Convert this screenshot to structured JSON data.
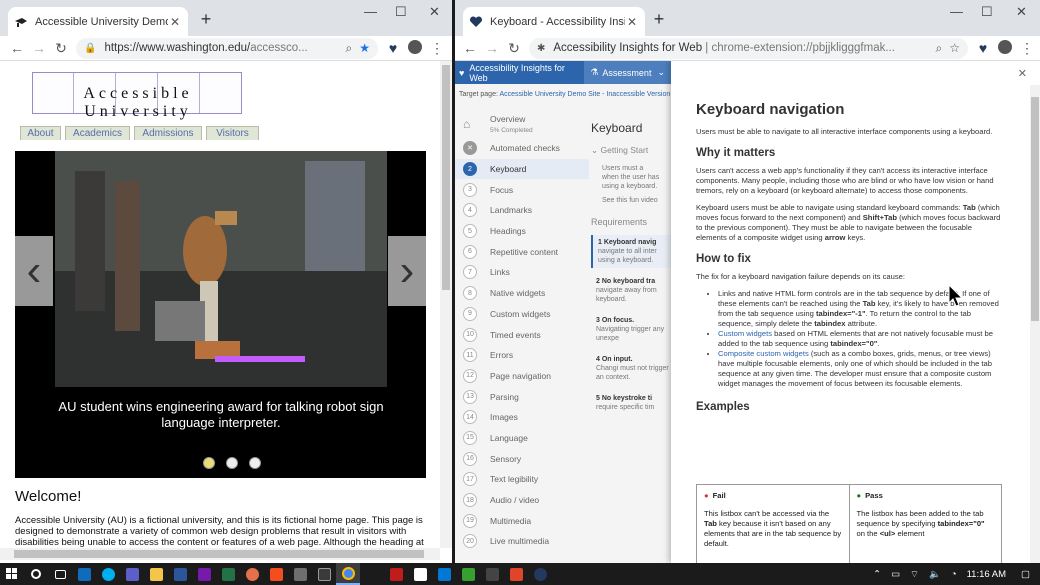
{
  "left": {
    "tab_title": "Accessible University Demo Site",
    "url_host": "https://www.washington.edu/",
    "url_path": "accessco...",
    "logo_text": "Accessible University",
    "nav": [
      "About",
      "Academics",
      "Admissions",
      "Visitors"
    ],
    "caption": "AU student wins engineering award for talking robot sign language interpreter.",
    "welcome": "Welcome!",
    "intro": "Accessible University (AU) is a fictional university, and this is its fictional home page. This page is designed to demonstrate a variety of common web design problems that result in visitors with disabilities being unable to access the content or features of a web page. Although the heading at the"
  },
  "right": {
    "tab_title": "Keyboard - Accessibility Insights",
    "url_label": "Accessibility Insights for Web",
    "url": "chrome-extension://pbjjkligggfmak...",
    "brand": "Accessibility Insights for Web",
    "assessment": "Assessment",
    "target_label": "Target page:",
    "target_link": "Accessible University Demo Site - Inaccessible Version",
    "overview": "Overview",
    "overview_sub": "5% Completed",
    "nav": [
      {
        "n": "",
        "label": "Automated checks"
      },
      {
        "n": "2",
        "label": "Keyboard"
      },
      {
        "n": "3",
        "label": "Focus"
      },
      {
        "n": "4",
        "label": "Landmarks"
      },
      {
        "n": "5",
        "label": "Headings"
      },
      {
        "n": "6",
        "label": "Repetitive content"
      },
      {
        "n": "7",
        "label": "Links"
      },
      {
        "n": "8",
        "label": "Native widgets"
      },
      {
        "n": "9",
        "label": "Custom widgets"
      },
      {
        "n": "10",
        "label": "Timed events"
      },
      {
        "n": "11",
        "label": "Errors"
      },
      {
        "n": "12",
        "label": "Page navigation"
      },
      {
        "n": "13",
        "label": "Parsing"
      },
      {
        "n": "14",
        "label": "Images"
      },
      {
        "n": "15",
        "label": "Language"
      },
      {
        "n": "16",
        "label": "Sensory"
      },
      {
        "n": "17",
        "label": "Text legibility"
      },
      {
        "n": "18",
        "label": "Audio / video"
      },
      {
        "n": "19",
        "label": "Multimedia"
      },
      {
        "n": "20",
        "label": "Live multimedia"
      }
    ],
    "mid_title": "Keyboard",
    "mid_getting": "Getting Start",
    "mid_lines": [
      "Users must a",
      "when the user has",
      "using a keyboard.",
      "See this fun video"
    ],
    "mid_req": "Requirements",
    "mid_items": [
      {
        "h": "1 Keyboard navig",
        "s": "navigate to all inter using a keyboard."
      },
      {
        "h": "2 No keyboard tra",
        "s": "navigate away from keyboard."
      },
      {
        "h": "3 On focus.",
        "s": "Navigating trigger any unexpe"
      },
      {
        "h": "4 On input.",
        "s": "Changi must not trigger an context."
      },
      {
        "h": "5 No keystroke ti",
        "s": "require specific tim"
      }
    ],
    "guide": {
      "h1": "Keyboard navigation",
      "p1": "Users must be able to navigate to all interactive interface components using a keyboard.",
      "h2a": "Why it matters",
      "p2": "Users can't access a web app's functionality if they can't access its interactive interface components. Many people, including those who are blind or who have low vision or hand tremors, rely on a keyboard (or keyboard alternate) to access those components.",
      "p3a": "Keyboard users must be able to navigate using standard keyboard commands: ",
      "p3tab": "Tab",
      "p3b": " (which moves focus forward to the next component) and ",
      "p3st": "Shift+Tab",
      "p3c": " (which moves focus backward to the previous component). They must be able to navigate between the focusable elements of a composite widget using ",
      "p3ar": "arrow",
      "p3d": " keys.",
      "h2b": "How to fix",
      "p4": "The fix for a keyboard navigation failure depends on its cause:",
      "li1a": "Links and native HTML form controls are in the tab sequence by default. If one of these elements can't be reached using the ",
      "li1tab": "Tab",
      "li1b": " key, it's likely to have been removed from the tab sequence using ",
      "li1code": "tabindex=\"-1\"",
      "li1c": ". To return the control to the tab sequence, simply delete the ",
      "li1code2": "tabindex",
      "li1d": " attribute.",
      "li2link": "Custom widgets",
      "li2a": " based on HTML elements that are not natively focusable must be added to the tab sequence using ",
      "li2code": "tabindex=\"0\"",
      "li2b": ".",
      "li3link": "Composite custom widgets",
      "li3a": " (such as a combo boxes, grids, menus, or tree views) have multiple focusable elements, only one of which should be included in the tab sequence at any given time. The developer must ensure that a composite custom widget manages the movement of focus between its focusable elements.",
      "h2c": "Examples",
      "fail": "Fail",
      "fail_t1": "This listbox can't be accessed via the ",
      "fail_tab": "Tab",
      "fail_t2": " key because it isn't based on any elements that are in the tab sequence by default.",
      "pass": "Pass",
      "pass_t1": "The listbox has been added to the tab sequence by specifying ",
      "pass_code": "tabindex=\"0\"",
      "pass_t2": " on the ",
      "pass_ul": "<ul>",
      "pass_t3": " element"
    }
  },
  "taskbar": {
    "time": "11:16 AM"
  },
  "colors": {
    "brand": "#2d65ac",
    "fail": "#d13438",
    "pass": "#107c10"
  }
}
